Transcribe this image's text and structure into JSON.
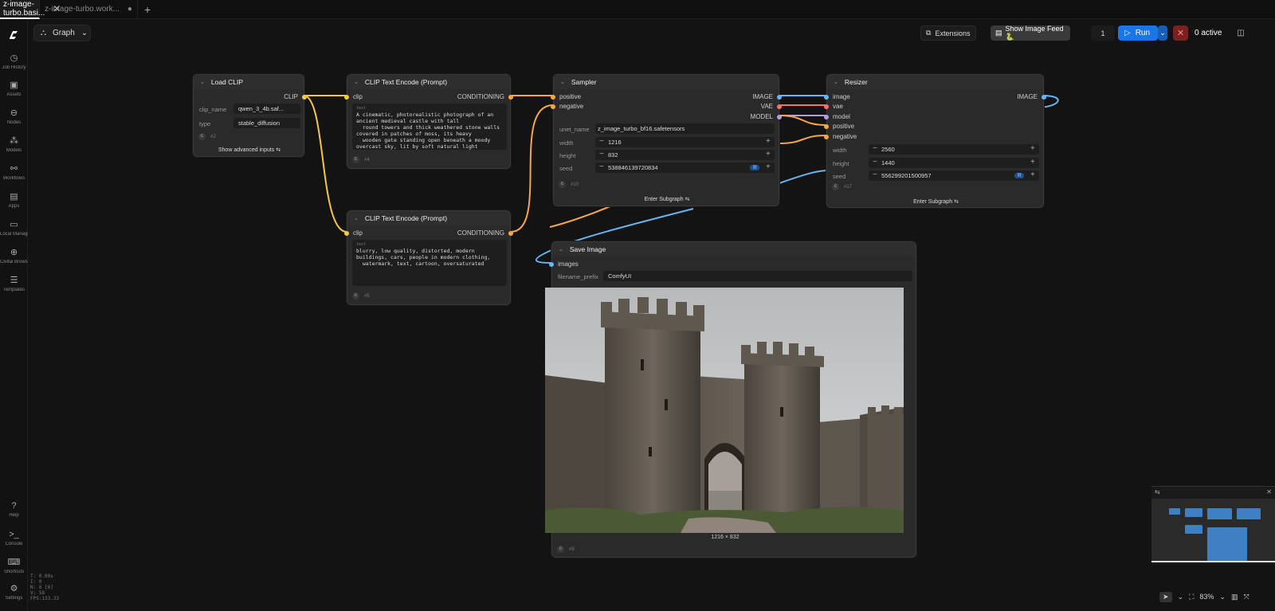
{
  "tabs": [
    {
      "label": "z-image-turbo.basi...",
      "active": true
    },
    {
      "label": "z-image-turbo.work...",
      "active": false
    }
  ],
  "sidebar": {
    "items": [
      {
        "label": "Job History",
        "icon": "history-icon"
      },
      {
        "label": "Assets",
        "icon": "image-icon"
      },
      {
        "label": "Nodes",
        "icon": "nodes-icon"
      },
      {
        "label": "Models",
        "icon": "models-icon"
      },
      {
        "label": "Workflows",
        "icon": "workflow-icon"
      },
      {
        "label": "Apps",
        "icon": "apps-icon"
      },
      {
        "label": "Local Manage",
        "icon": "folder-icon"
      },
      {
        "label": "Civitai Browse",
        "icon": "globe-icon"
      },
      {
        "label": "Templates",
        "icon": "templates-icon"
      }
    ],
    "bottom": [
      {
        "label": "Help",
        "icon": "help-icon"
      },
      {
        "label": "Console",
        "icon": "console-icon"
      },
      {
        "label": "Shortcuts",
        "icon": "keyboard-icon"
      },
      {
        "label": "Settings",
        "icon": "gear-icon"
      }
    ]
  },
  "stats": [
    "T: 0.00s",
    "I: 0",
    "N: 6 [6]",
    "V: 58",
    "FPS:133.33"
  ],
  "graph_label": "Graph",
  "toolbar": {
    "extensions": "Extensions",
    "show_feed": "Show Image Feed 🐍",
    "queue_count": "1",
    "run": "Run",
    "active": "0 active"
  },
  "nodes": {
    "load_clip": {
      "title": "Load CLIP",
      "output": "CLIP",
      "clip_name_label": "clip_name",
      "clip_name": "qwen_3_4b.saf...",
      "type_label": "type",
      "type": "stable_diffusion",
      "id": "#2",
      "advanced": "Show advanced inputs"
    },
    "clip_pos": {
      "title": "CLIP Text Encode (Prompt)",
      "input": "clip",
      "output": "CONDITIONING",
      "text_label": "text",
      "text": "A cinematic, photorealistic photograph of an\nancient medieval castle with tall\n  round towers and thick weathered stone walls\ncovered in patches of moss, its heavy\n  wooden gate standing open beneath a moody\novercast sky, lit by soft natural light\n  with fine, highly detailed textures",
      "id": "#4"
    },
    "clip_neg": {
      "title": "CLIP Text Encode (Prompt)",
      "input": "clip",
      "output": "CONDITIONING",
      "text_label": "text",
      "text": "blurry, low quality, distorted, modern\nbuildings, cars, people in modern clothing,\n  watermark, text, cartoon, oversaturated",
      "id": "#5"
    },
    "sampler": {
      "title": "Sampler",
      "in_positive": "positive",
      "in_negative": "negative",
      "out_image": "IMAGE",
      "out_vae": "VAE",
      "out_model": "MODEL",
      "unet_label": "unet_name",
      "unet": "z_image_turbo_bf16.safetensors",
      "width_label": "width",
      "width": "1216",
      "height_label": "height",
      "height": "832",
      "seed_label": "seed",
      "seed": "538846139720834",
      "id": "#10",
      "subgraph": "Enter Subgraph"
    },
    "resizer": {
      "title": "Resizer",
      "in_image": "image",
      "in_vae": "vae",
      "in_model": "model",
      "in_positive": "positive",
      "in_negative": "negative",
      "out_image": "IMAGE",
      "width_label": "width",
      "width": "2560",
      "height_label": "height",
      "height": "1440",
      "seed_label": "seed",
      "seed": "556299201500957",
      "id": "#17",
      "subgraph": "Enter Subgraph"
    },
    "save": {
      "title": "Save Image",
      "input": "images",
      "prefix_label": "filename_prefix",
      "prefix": "ComfyUI",
      "caption": "1216 × 832",
      "id": "#9"
    }
  },
  "zoom": "83%",
  "colors": {
    "clip": "#f5c842",
    "conditioning": "#f5a742",
    "image": "#64b5f6",
    "vae": "#ff6e6e",
    "model": "#b39ddb",
    "run": "#1a75e6"
  }
}
